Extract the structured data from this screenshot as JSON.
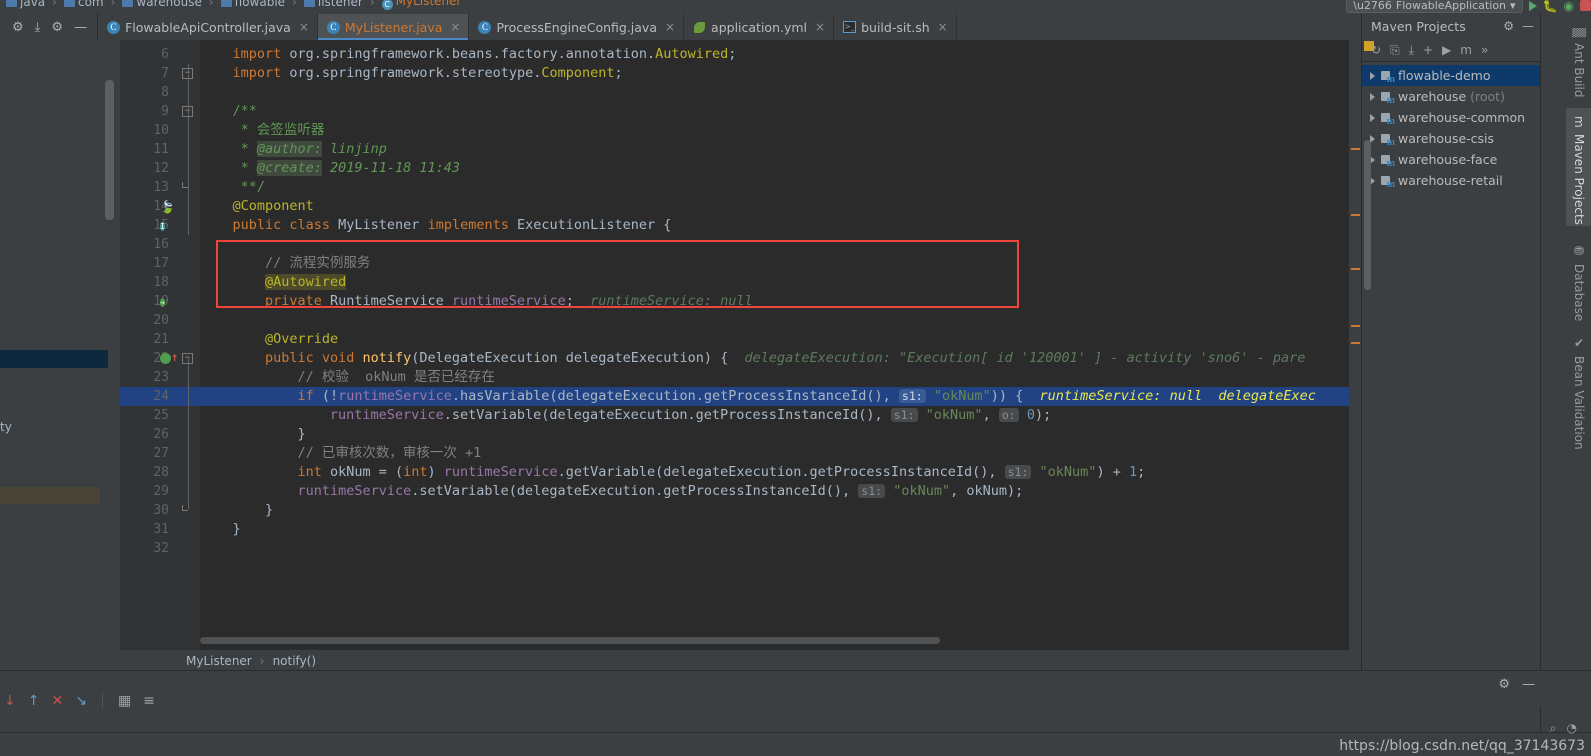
{
  "breadcrumb_top": {
    "items": [
      "java",
      "com",
      "warehouse",
      "flowable",
      "listener",
      "MyListener"
    ],
    "separator": "›"
  },
  "run_config": {
    "name": "FlowableApplication",
    "dropdown_caret": "▾"
  },
  "editor_toolbar": {
    "settings_icon": "⚙",
    "collapse_icon": "⤓",
    "gear_icon": "⚙",
    "minimize_icon": "—"
  },
  "tabs": [
    {
      "label": "FlowableApiController.java",
      "icon": "java-class-icon",
      "icon_glyph": "C",
      "active": false,
      "close": "×"
    },
    {
      "label": "MyListener.java",
      "icon": "java-class-icon",
      "icon_glyph": "C",
      "active": true,
      "close": "×"
    },
    {
      "label": "ProcessEngineConfig.java",
      "icon": "java-class-icon",
      "icon_glyph": "C",
      "active": false,
      "close": "×"
    },
    {
      "label": "application.yml",
      "icon": "yaml-leaf-icon",
      "icon_glyph": "",
      "active": false,
      "close": "×"
    },
    {
      "label": "build-sit.sh",
      "icon": "shell-script-icon",
      "icon_glyph": "❯_",
      "active": false,
      "close": "×"
    }
  ],
  "code_lines": [
    {
      "num": 6,
      "indent": 4,
      "segments": [
        {
          "t": "import ",
          "c": "kw"
        },
        {
          "t": "org.springframework.beans.factory.annotation.",
          "c": "cls"
        },
        {
          "t": "Autowired",
          "c": "ann"
        },
        {
          "t": ";",
          "c": "cls"
        }
      ]
    },
    {
      "num": 7,
      "indent": 4,
      "fold": "minus",
      "segments": [
        {
          "t": "import ",
          "c": "kw"
        },
        {
          "t": "org.springframework.stereotype.",
          "c": "cls"
        },
        {
          "t": "Component",
          "c": "ann"
        },
        {
          "t": ";",
          "c": "cls"
        }
      ]
    },
    {
      "num": 8,
      "indent": 0,
      "segments": []
    },
    {
      "num": 9,
      "indent": 4,
      "fold": "minus",
      "segments": [
        {
          "t": "/**",
          "c": "doc"
        }
      ]
    },
    {
      "num": 10,
      "indent": 5,
      "segments": [
        {
          "t": "* 会签监听器",
          "c": "doc"
        }
      ]
    },
    {
      "num": 11,
      "indent": 5,
      "segments": [
        {
          "t": "* ",
          "c": "doc"
        },
        {
          "t": "@author:",
          "c": "tag",
          "hl": "doctag"
        },
        {
          "t": " linjinp",
          "c": "tag"
        }
      ]
    },
    {
      "num": 12,
      "indent": 5,
      "segments": [
        {
          "t": "* ",
          "c": "doc"
        },
        {
          "t": "@create:",
          "c": "tag",
          "hl": "doctag"
        },
        {
          "t": " 2019-11-18 11:43",
          "c": "tag"
        }
      ]
    },
    {
      "num": 13,
      "indent": 5,
      "fold": "end",
      "segments": [
        {
          "t": "**/",
          "c": "doc"
        }
      ]
    },
    {
      "num": 14,
      "indent": 4,
      "gicon": "bean-icon",
      "segments": [
        {
          "t": "@Component",
          "c": "ann"
        }
      ]
    },
    {
      "num": 15,
      "indent": 4,
      "gicon": "implemented-icon",
      "segments": [
        {
          "t": "public ",
          "c": "kw"
        },
        {
          "t": "class ",
          "c": "kw"
        },
        {
          "t": "MyListener ",
          "c": "cls"
        },
        {
          "t": "implements ",
          "c": "kw"
        },
        {
          "t": "ExecutionListener {",
          "c": "cls"
        }
      ]
    },
    {
      "num": 16,
      "indent": 0,
      "segments": []
    },
    {
      "num": 17,
      "indent": 8,
      "segments": [
        {
          "t": "// 流程实例服务",
          "c": "cmt"
        }
      ]
    },
    {
      "num": 18,
      "indent": 8,
      "segments": [
        {
          "t": "@Autowired",
          "c": "ann",
          "hl": "ann"
        }
      ]
    },
    {
      "num": 19,
      "indent": 8,
      "gicon": "autowired-bean-icon",
      "segments": [
        {
          "t": "private ",
          "c": "kw"
        },
        {
          "t": "RuntimeService ",
          "c": "cls"
        },
        {
          "t": "runtimeService",
          "c": "fld"
        },
        {
          "t": ";",
          "c": "cls"
        },
        {
          "t": "  runtimeService: null",
          "c": "hint"
        }
      ]
    },
    {
      "num": 20,
      "indent": 0,
      "segments": []
    },
    {
      "num": 21,
      "indent": 8,
      "segments": [
        {
          "t": "@Override",
          "c": "ann"
        }
      ]
    },
    {
      "num": 22,
      "indent": 8,
      "gicon": "breakpoint-icon",
      "fold": "collapse",
      "segments": [
        {
          "t": "public ",
          "c": "kw"
        },
        {
          "t": "void ",
          "c": "kw"
        },
        {
          "t": "notify",
          "c": "mth"
        },
        {
          "t": "(DelegateExecution delegateExecution) {",
          "c": "cls"
        },
        {
          "t": "  delegateExecution: \"Execution[ id '120001' ] - activity 'sno6' - pare",
          "c": "hint"
        }
      ]
    },
    {
      "num": 23,
      "indent": 12,
      "segments": [
        {
          "t": "// 校验  okNum 是否已经存在",
          "c": "cmt"
        }
      ]
    },
    {
      "num": 24,
      "indent": 12,
      "selected": true,
      "segments": [
        {
          "t": "if ",
          "c": "kw"
        },
        {
          "t": "(!",
          "c": "cls"
        },
        {
          "t": "runtimeService",
          "c": "fld"
        },
        {
          "t": ".hasVariable(delegateExecution.getProcessInstanceId(), ",
          "c": "cls"
        },
        {
          "t": "s1:",
          "c": "box"
        },
        {
          "t": " ",
          "c": "cls"
        },
        {
          "t": "\"okNum\"",
          "c": "str"
        },
        {
          "t": ")) {",
          "c": "cls"
        },
        {
          "t": "  runtimeService: null  delegateExec",
          "c": "hint"
        }
      ]
    },
    {
      "num": 25,
      "indent": 16,
      "segments": [
        {
          "t": "runtimeService",
          "c": "fld"
        },
        {
          "t": ".setVariable(delegateExecution.getProcessInstanceId(), ",
          "c": "cls"
        },
        {
          "t": "s1:",
          "c": "box"
        },
        {
          "t": " ",
          "c": "cls"
        },
        {
          "t": "\"okNum\"",
          "c": "str"
        },
        {
          "t": ", ",
          "c": "cls"
        },
        {
          "t": "o:",
          "c": "box"
        },
        {
          "t": " ",
          "c": "cls"
        },
        {
          "t": "0",
          "c": "num"
        },
        {
          "t": ");",
          "c": "cls"
        }
      ]
    },
    {
      "num": 26,
      "indent": 12,
      "segments": [
        {
          "t": "}",
          "c": "cls"
        }
      ]
    },
    {
      "num": 27,
      "indent": 12,
      "segments": [
        {
          "t": "// 已审核次数，审核一次 +1",
          "c": "cmt"
        }
      ]
    },
    {
      "num": 28,
      "indent": 12,
      "segments": [
        {
          "t": "int ",
          "c": "kw"
        },
        {
          "t": "okNum = ",
          "c": "cls"
        },
        {
          "t": "(",
          "c": "cls"
        },
        {
          "t": "int",
          "c": "kw"
        },
        {
          "t": ") ",
          "c": "cls"
        },
        {
          "t": "runtimeService",
          "c": "fld"
        },
        {
          "t": ".getVariable(delegateExecution.getProcessInstanceId(), ",
          "c": "cls"
        },
        {
          "t": "s1:",
          "c": "box"
        },
        {
          "t": " ",
          "c": "cls"
        },
        {
          "t": "\"okNum\"",
          "c": "str"
        },
        {
          "t": ") + ",
          "c": "cls"
        },
        {
          "t": "1",
          "c": "num"
        },
        {
          "t": ";",
          "c": "cls"
        }
      ]
    },
    {
      "num": 29,
      "indent": 12,
      "segments": [
        {
          "t": "runtimeService",
          "c": "fld"
        },
        {
          "t": ".setVariable(delegateExecution.getProcessInstanceId(), ",
          "c": "cls"
        },
        {
          "t": "s1:",
          "c": "box"
        },
        {
          "t": " ",
          "c": "cls"
        },
        {
          "t": "\"okNum\"",
          "c": "str"
        },
        {
          "t": ", okNum);",
          "c": "cls"
        }
      ]
    },
    {
      "num": 30,
      "indent": 8,
      "fold": "end",
      "segments": [
        {
          "t": "}",
          "c": "cls"
        }
      ]
    },
    {
      "num": 31,
      "indent": 4,
      "segments": [
        {
          "t": "}",
          "c": "cls"
        }
      ]
    },
    {
      "num": 32,
      "indent": 0,
      "segments": []
    }
  ],
  "annotation_box": {
    "color": "#f0453f",
    "label": "red-highlight-box"
  },
  "editor_breadcrumb": {
    "class_name": "MyListener",
    "separator": "›",
    "method_name": "notify()"
  },
  "maven_panel": {
    "title": "Maven Projects",
    "gear_icon": "⚙",
    "minimize_icon": "—",
    "toolbar": [
      {
        "name": "reimport-icon",
        "glyph": "↻"
      },
      {
        "name": "download-sources-icon",
        "glyph": "⎘"
      },
      {
        "name": "collect-dependencies-icon",
        "glyph": "⤓"
      },
      {
        "name": "add-maven-project-icon",
        "glyph": "+"
      },
      {
        "name": "run-goal-icon",
        "glyph": "▶"
      },
      {
        "name": "execute-maven-goal-icon",
        "glyph": "m"
      },
      {
        "name": "more-icon",
        "glyph": "»"
      }
    ],
    "projects": [
      {
        "label": "flowable-demo",
        "suffix": "",
        "selected": true
      },
      {
        "label": "warehouse",
        "suffix": "(root)",
        "selected": false
      },
      {
        "label": "warehouse-common",
        "suffix": "",
        "selected": false
      },
      {
        "label": "warehouse-csis",
        "suffix": "",
        "selected": false
      },
      {
        "label": "warehouse-face",
        "suffix": "",
        "selected": false
      },
      {
        "label": "warehouse-retail",
        "suffix": "",
        "selected": false
      }
    ]
  },
  "right_tool_tabs": [
    {
      "label": "Ant Build",
      "icon": "ant-icon",
      "glyph": "▒",
      "active": false
    },
    {
      "label": "Maven Projects",
      "icon": "maven-icon",
      "glyph": "m",
      "active": true
    },
    {
      "label": "Database",
      "icon": "database-icon",
      "glyph": "⛃",
      "active": false
    },
    {
      "label": "Bean Validation",
      "icon": "bean-validation-icon",
      "glyph": "✔",
      "active": false
    }
  ],
  "debug_toolbar": {
    "icons": [
      {
        "name": "step-over-icon",
        "glyph": "↓"
      },
      {
        "name": "step-into-icon",
        "glyph": "↑"
      },
      {
        "name": "force-step-into-icon",
        "glyph": "✕"
      },
      {
        "name": "step-out-icon",
        "glyph": "↘"
      },
      {
        "name": "evaluate-expression-icon",
        "glyph": "▦"
      },
      {
        "name": "settings-toggle-icon",
        "glyph": "≡"
      }
    ],
    "gear_icon": "⚙",
    "minimize_icon": "—"
  },
  "status_bar": {
    "watermark": "https://blog.csdn.net/qq_37143673",
    "icons": [
      {
        "name": "magnifier-icon",
        "glyph": "⌕"
      },
      {
        "name": "notification-icon",
        "glyph": "◔"
      }
    ]
  },
  "colors": {
    "background": "#3c3f41",
    "editor_bg": "#2b2b2b",
    "gutter_bg": "#313335",
    "accent_blue": "#4a88c7",
    "selection_blue": "#214283",
    "tab_active_text": "#cc7832",
    "red_box": "#f0453f",
    "tree_selection": "#0d3a6b"
  }
}
